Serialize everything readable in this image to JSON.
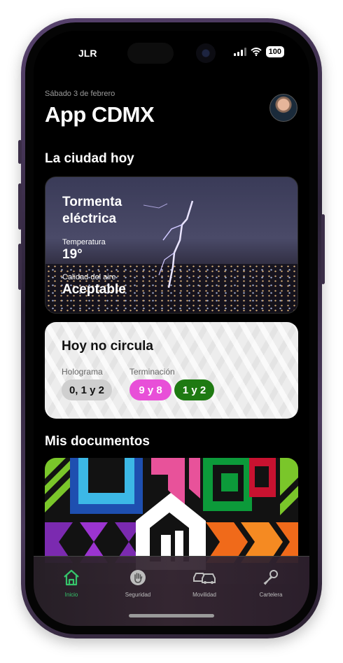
{
  "status_bar": {
    "carrier": "JLR",
    "battery": "100"
  },
  "header": {
    "date": "Sábado 3 de febrero",
    "title": "App CDMX"
  },
  "city_today": {
    "section_title": "La ciudad hoy",
    "condition": "Tormenta eléctrica",
    "temperature_label": "Temperatura",
    "temperature": "19°",
    "air_label": "Calidad del aire",
    "air_quality": "Aceptable"
  },
  "hoy_no_circula": {
    "title": "Hoy no circula",
    "hologram_label": "Holograma",
    "hologram_value": "0, 1 y 2",
    "termination_label": "Terminación",
    "termination_values": [
      "9 y 8",
      "1 y 2"
    ],
    "colors": {
      "hologram": "#cfcfcf",
      "pink": "#e84fd8",
      "green": "#1e7a12"
    }
  },
  "documents": {
    "section_title": "Mis documentos"
  },
  "tabbar": {
    "tabs": [
      {
        "label": "Inicio",
        "icon": "home-icon"
      },
      {
        "label": "Seguridad",
        "icon": "hand-stop-icon"
      },
      {
        "label": "Movilidad",
        "icon": "cars-icon"
      },
      {
        "label": "Cartelera",
        "icon": "microphone-icon"
      }
    ],
    "active_color": "#35c46a"
  }
}
